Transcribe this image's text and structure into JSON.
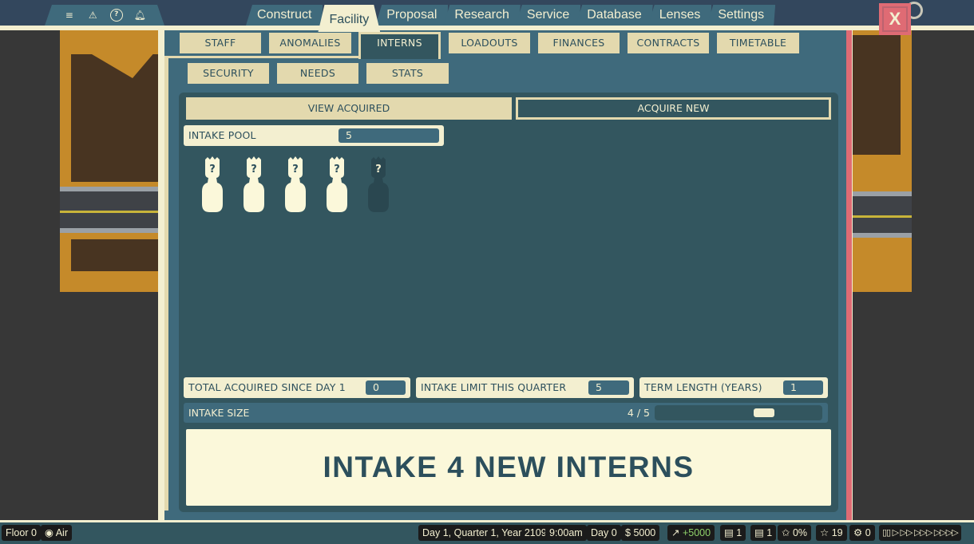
{
  "topbar": {
    "icons": [
      "menu-icon",
      "warning-icon",
      "help-icon",
      "bell-icon"
    ],
    "tabs": [
      "Construct",
      "Facility",
      "Proposal",
      "Research",
      "Service",
      "Database",
      "Lenses",
      "Settings"
    ],
    "active_tab": "Facility",
    "close_label": "X"
  },
  "subtabs": {
    "row1": [
      "STAFF",
      "ANOMALIES",
      "INTERNS",
      "LOADOUTS",
      "FINANCES",
      "CONTRACTS",
      "TIMETABLE"
    ],
    "row2": [
      "SECURITY",
      "NEEDS",
      "STATS"
    ],
    "active": "INTERNS"
  },
  "interns_panel": {
    "view_acquired": "VIEW ACQUIRED",
    "acquire_new": "ACQUIRE NEW",
    "intake_pool_label": "INTAKE POOL",
    "intake_pool_value": "5",
    "pool_slots": [
      {
        "selected": true,
        "symbol": "?"
      },
      {
        "selected": true,
        "symbol": "?"
      },
      {
        "selected": true,
        "symbol": "?"
      },
      {
        "selected": true,
        "symbol": "?"
      },
      {
        "selected": false,
        "symbol": "?"
      }
    ],
    "total_acquired_label": "TOTAL ACQUIRED SINCE DAY 1",
    "total_acquired_value": "0",
    "intake_limit_label": "INTAKE LIMIT THIS QUARTER",
    "intake_limit_value": "5",
    "term_length_label": "TERM LENGTH (YEARS)",
    "term_length_value": "1",
    "intake_size_label": "INTAKE SIZE",
    "intake_size_count": "4 / 5",
    "intake_size_fraction": 0.8,
    "action_button": "INTAKE 4 NEW INTERNS"
  },
  "statusbar": {
    "floor": "Floor 0",
    "view_mode": "Air",
    "date": "Day 1, Quarter 1, Year 2109",
    "time": "9:00am",
    "day": "Day 0",
    "money": "5000",
    "income": "+5000",
    "count_a": "1",
    "count_b": "1",
    "percent": "0%",
    "stars": "19",
    "bugs": "0",
    "speed_controls": "▯▯ ▷ ▷▷ ▷▷▷ ▷▷▷▷"
  },
  "colors": {
    "panel": "#3f6a7c",
    "panel_dark": "#33565f",
    "cream": "#f3efd0",
    "text_dark": "#2c4f5c",
    "close_red": "#df6b74",
    "income_green": "#8fd16a"
  }
}
